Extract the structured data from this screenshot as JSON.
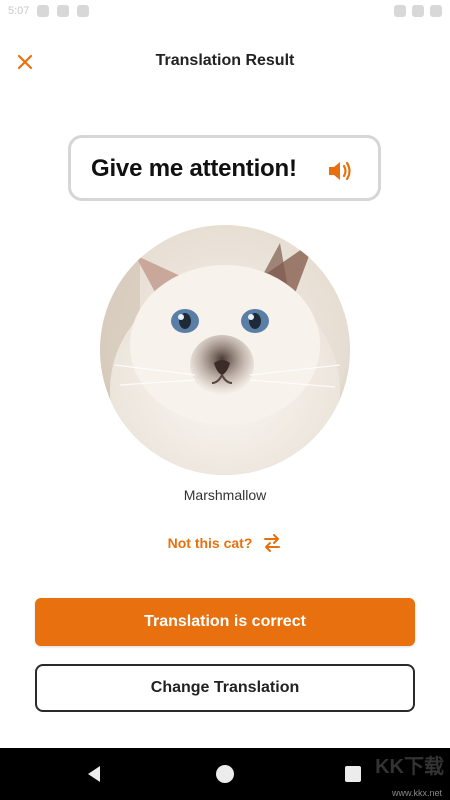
{
  "status_bar": {
    "left_text": "5:07",
    "right_text": ""
  },
  "header": {
    "title": "Translation Result",
    "close_icon": "close-icon"
  },
  "bubble": {
    "text": "Give me attention!",
    "icon": "speaker-icon"
  },
  "cat": {
    "name": "Marshmallow"
  },
  "not_this_cat": {
    "label": "Not this cat?",
    "icon": "swap-arrows-icon"
  },
  "actions": {
    "primary_label": "Translation is correct",
    "secondary_label": "Change Translation"
  },
  "nav": {
    "back": "back-icon",
    "home": "home-icon",
    "recent": "recent-apps-icon"
  },
  "watermark": {
    "text": "KK下载",
    "url": "www.kkx.net"
  },
  "colors": {
    "accent": "#e8700e",
    "bubble_border": "#d6d6d6",
    "nav_bg": "#000000"
  }
}
